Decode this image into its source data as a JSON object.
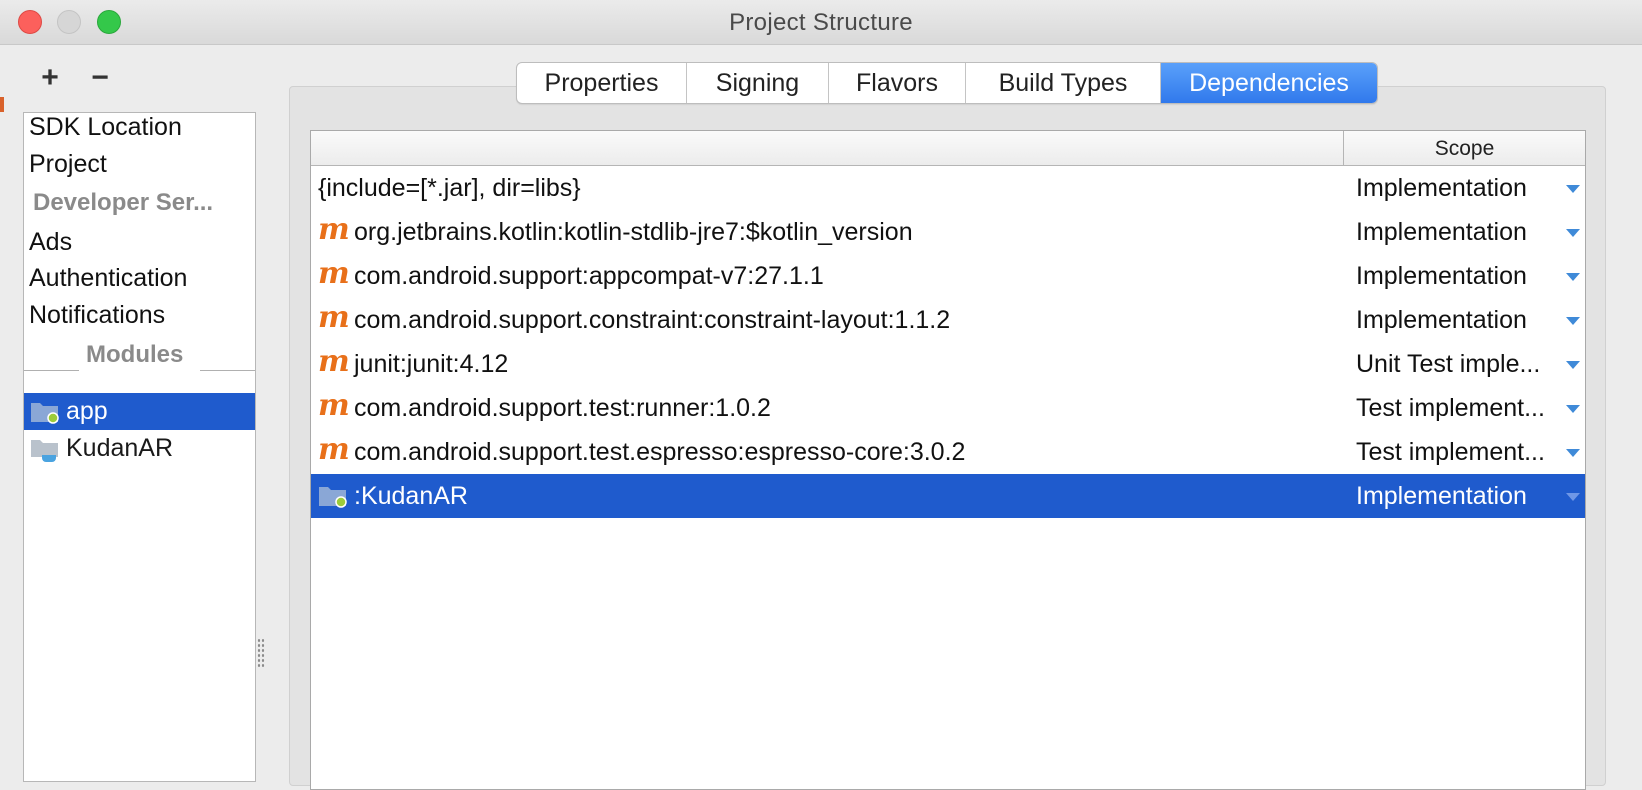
{
  "window": {
    "title": "Project Structure"
  },
  "toolbar": {
    "add_label": "+",
    "remove_label": "−"
  },
  "sidebar": {
    "items": [
      "SDK Location",
      "Project"
    ],
    "developer_header": "Developer Ser...",
    "developer_items": [
      "Ads",
      "Authentication",
      "Notifications"
    ],
    "modules_header": "Modules",
    "modules": [
      {
        "label": "app",
        "selected": true
      },
      {
        "label": "KudanAR",
        "selected": false
      }
    ]
  },
  "tabs": [
    {
      "label": "Properties",
      "active": false
    },
    {
      "label": "Signing",
      "active": false
    },
    {
      "label": "Flavors",
      "active": false
    },
    {
      "label": "Build Types",
      "active": false
    },
    {
      "label": "Dependencies",
      "active": true
    }
  ],
  "dependencies": {
    "columns": {
      "name": "",
      "scope": "Scope"
    },
    "rows": [
      {
        "icon": "none",
        "name": "{include=[*.jar], dir=libs}",
        "scope": "Implementation"
      },
      {
        "icon": "maven-icon",
        "name": "org.jetbrains.kotlin:kotlin-stdlib-jre7:$kotlin_version",
        "scope": "Implementation"
      },
      {
        "icon": "maven-icon",
        "name": "com.android.support:appcompat-v7:27.1.1",
        "scope": "Implementation"
      },
      {
        "icon": "maven-icon",
        "name": "com.android.support.constraint:constraint-layout:1.1.2",
        "scope": "Implementation"
      },
      {
        "icon": "maven-icon",
        "name": "junit:junit:4.12",
        "scope": "Unit Test imple..."
      },
      {
        "icon": "maven-icon",
        "name": "com.android.support.test:runner:1.0.2",
        "scope": "Test implement..."
      },
      {
        "icon": "maven-icon",
        "name": "com.android.support.test.espresso:espresso-core:3.0.2",
        "scope": "Test implement..."
      },
      {
        "icon": "module-folder-icon",
        "name": ":KudanAR",
        "scope": "Implementation",
        "selected": true
      }
    ]
  },
  "colors": {
    "selection": "#1f5bcd",
    "tab_active": "#3a84f0",
    "maven_icon": "#e8701a",
    "dropdown_arrow": "#3f8ad8"
  }
}
